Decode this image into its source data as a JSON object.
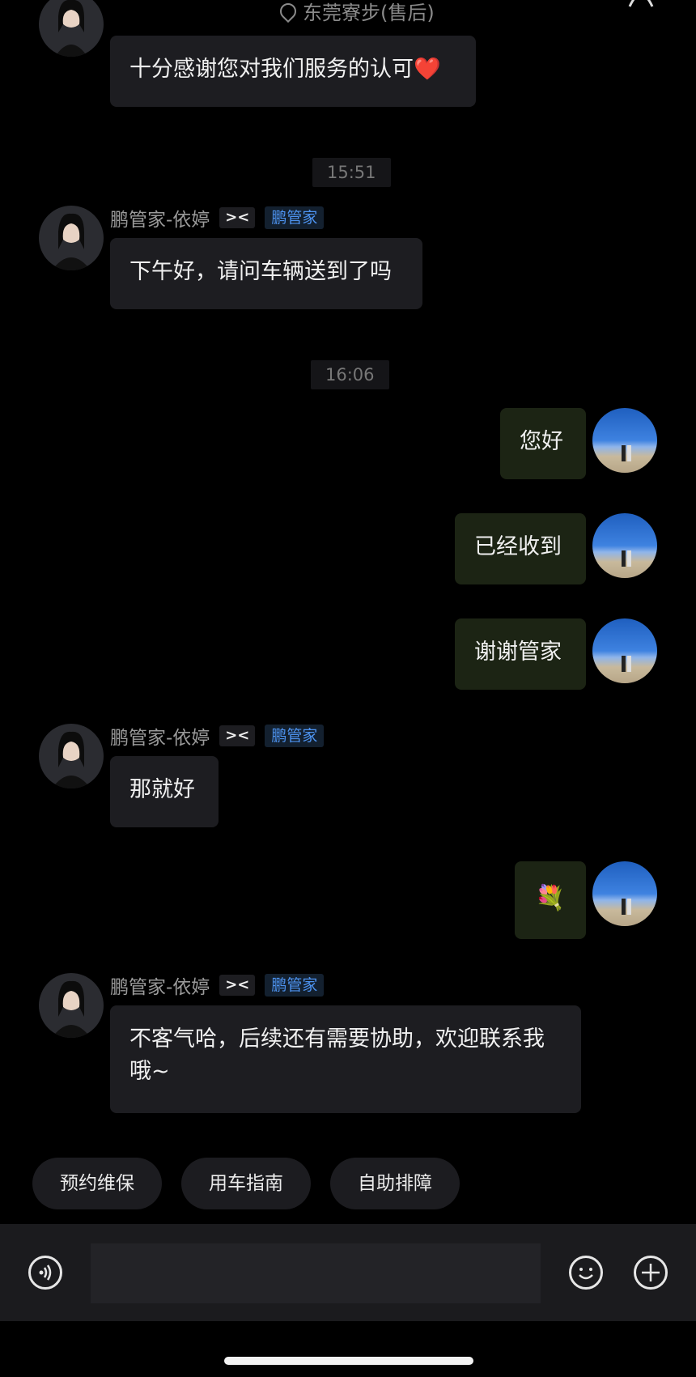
{
  "header": {
    "location": "东莞寮步(售后)"
  },
  "messages": [
    {
      "side": "agent",
      "text": "十分感谢您对我们服务的认可❤️"
    },
    {
      "time": "15:51"
    },
    {
      "side": "agent",
      "name": "鹏管家-依婷",
      "badge": "鹏管家",
      "text": "下午好，请问车辆送到了吗"
    },
    {
      "time": "16:06"
    },
    {
      "side": "user",
      "text": "您好"
    },
    {
      "side": "user",
      "text": "已经收到"
    },
    {
      "side": "user",
      "text": "谢谢管家"
    },
    {
      "side": "agent",
      "name": "鹏管家-依婷",
      "badge": "鹏管家",
      "text": "那就好"
    },
    {
      "side": "user",
      "text": "💐"
    },
    {
      "side": "agent",
      "name": "鹏管家-依婷",
      "badge": "鹏管家",
      "text": "不客气哈，后续还有需要协助，欢迎联系我哦~"
    }
  ],
  "quick_replies": [
    "预约维保",
    "用车指南",
    "自助排障"
  ],
  "brand_logo": "xpeng-x-logo",
  "colors": {
    "agent_bubble": "#1d1d21",
    "user_bubble": "#1c2414",
    "badge": "#4d93f0"
  }
}
